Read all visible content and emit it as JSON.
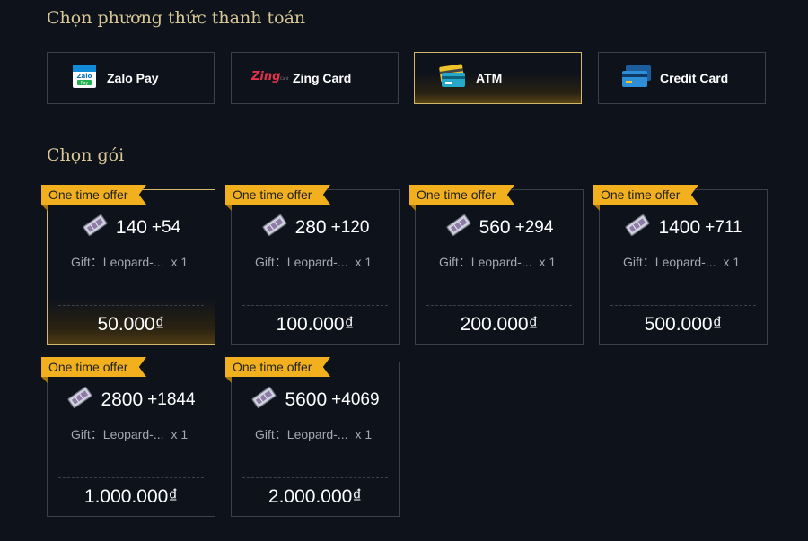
{
  "payment_section": {
    "title": "Chọn phương thức thanh toán",
    "methods": [
      {
        "label": "Zalo Pay",
        "icon": "zalopay-icon",
        "selected": false
      },
      {
        "label": "Zing Card",
        "icon": "zingcard-icon",
        "selected": false
      },
      {
        "label": "ATM",
        "icon": "atm-card-icon",
        "selected": true
      },
      {
        "label": "Credit Card",
        "icon": "credit-card-icon",
        "selected": false
      }
    ]
  },
  "package_section": {
    "title": "Chọn gói",
    "packages": [
      {
        "badge": "One time offer",
        "amount": "140",
        "bonus": "+54",
        "gift": "Gift：Leopard-...",
        "gift_qty": "x 1",
        "price": "50.000₫",
        "selected": true
      },
      {
        "badge": "One time offer",
        "amount": "280",
        "bonus": "+120",
        "gift": "Gift：Leopard-...",
        "gift_qty": "x 1",
        "price": "100.000₫",
        "selected": false
      },
      {
        "badge": "One time offer",
        "amount": "560",
        "bonus": "+294",
        "gift": "Gift：Leopard-...",
        "gift_qty": "x 1",
        "price": "200.000₫",
        "selected": false
      },
      {
        "badge": "One time offer",
        "amount": "1400",
        "bonus": "+711",
        "gift": "Gift：Leopard-...",
        "gift_qty": "x 1",
        "price": "500.000₫",
        "selected": false
      },
      {
        "badge": "One time offer",
        "amount": "2800",
        "bonus": "+1844",
        "gift": "Gift：Leopard-...",
        "gift_qty": "x 1",
        "price": "1.000.000₫",
        "selected": false
      },
      {
        "badge": "One time offer",
        "amount": "5600",
        "bonus": "+4069",
        "gift": "Gift：Leopard-...",
        "gift_qty": "x 1",
        "price": "2.000.000₫",
        "selected": false
      }
    ]
  },
  "colors": {
    "background": "#0d121b",
    "accent_gold": "#d2b66a",
    "badge": "#f2b01e",
    "section_title": "#d9c796"
  }
}
